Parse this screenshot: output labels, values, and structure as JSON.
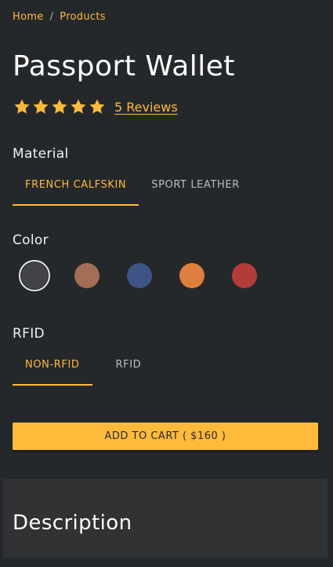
{
  "breadcrumb": {
    "home": "Home",
    "separator": "/",
    "current": "Products"
  },
  "product": {
    "title": "Passport Wallet",
    "rating": {
      "stars": 5,
      "max": 5
    },
    "reviews_label": "5 Reviews"
  },
  "material": {
    "label": "Material",
    "options": [
      "FRENCH CALFSKIN",
      "SPORT LEATHER"
    ],
    "selected": "FRENCH CALFSKIN"
  },
  "color": {
    "label": "Color",
    "swatches": [
      "#434448",
      "#a26e55",
      "#3e5485",
      "#dd7f3f",
      "#b33c38"
    ],
    "selected_index": 0
  },
  "rfid": {
    "label": "RFID",
    "options": [
      "NON-RFID",
      "RFID"
    ],
    "selected": "NON-RFID"
  },
  "cart": {
    "label": "ADD TO CART ( $160 )"
  },
  "description": {
    "heading": "Description"
  },
  "colors": {
    "accent": "#ffba3b",
    "background": "#25282b",
    "panel": "#303234"
  },
  "icons": {
    "star": "star-icon"
  }
}
